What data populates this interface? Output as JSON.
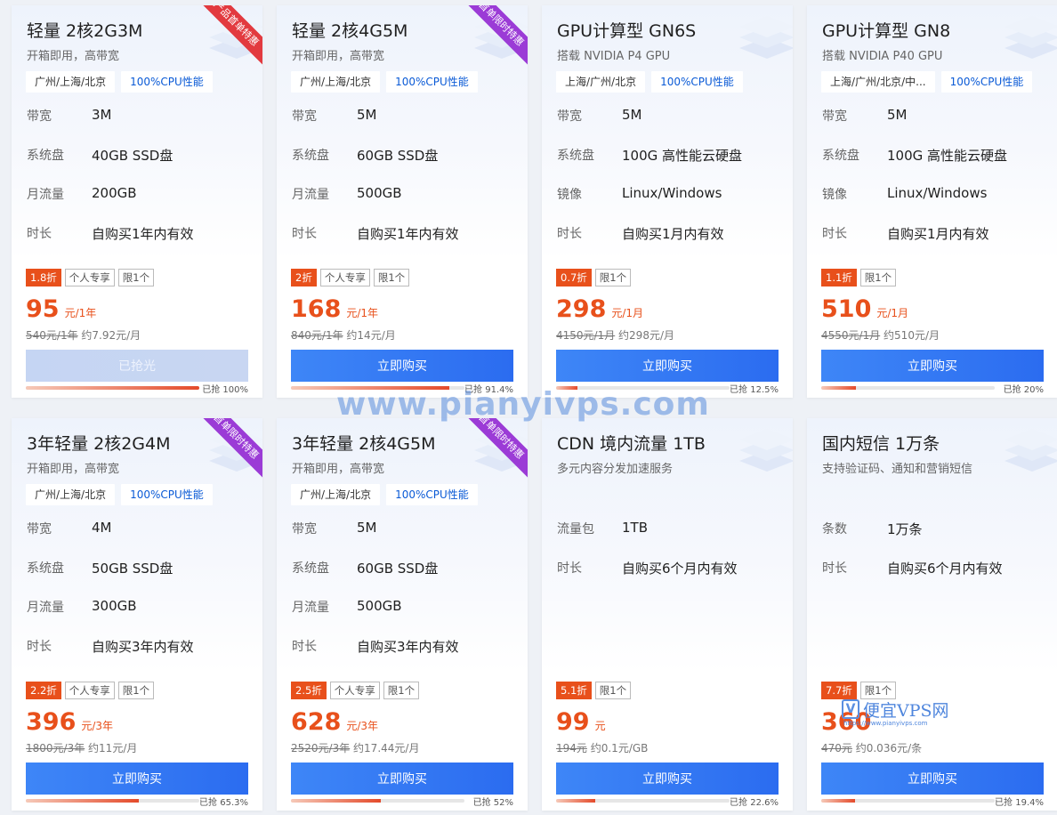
{
  "watermark": "www.pianyivps.com",
  "logo": {
    "mark": "V",
    "name": "便宜VPS网",
    "url": "https://www.pianyivps.com"
  },
  "cards": [
    {
      "title": "轻量 2核2G3M",
      "subtitle": "开箱即用，高带宽",
      "tags": [
        "广州/上海/北京",
        "100%CPU性能"
      ],
      "ribbon": "产品首单特惠",
      "specs": [
        {
          "k": "带宽",
          "v": "3M"
        },
        {
          "k": "系统盘",
          "v": "40GB SSD盘"
        },
        {
          "k": "月流量",
          "v": "200GB"
        },
        {
          "k": "时长",
          "v": "自购买1年内有效"
        }
      ],
      "discount": "1.8折",
      "badges": [
        "个人专享",
        "限1个"
      ],
      "price": "95",
      "unit": "元/1年",
      "orig": "540元/1年",
      "avg": "约7.92元/月",
      "button": "已抢光",
      "sold_text": "已抢 100%",
      "sold": 1.0
    },
    {
      "title": "轻量 2核4G5M",
      "subtitle": "开箱即用，高带宽",
      "tags": [
        "广州/上海/北京",
        "100%CPU性能"
      ],
      "ribbon": "首单限时特惠",
      "specs": [
        {
          "k": "带宽",
          "v": "5M"
        },
        {
          "k": "系统盘",
          "v": "60GB SSD盘"
        },
        {
          "k": "月流量",
          "v": "500GB"
        },
        {
          "k": "时长",
          "v": "自购买1年内有效"
        }
      ],
      "discount": "2折",
      "badges": [
        "个人专享",
        "限1个"
      ],
      "price": "168",
      "unit": "元/1年",
      "orig": "840元/1年",
      "avg": "约14元/月",
      "button": "立即购买",
      "sold_text": "已抢 91.4%",
      "sold": 0.914
    },
    {
      "title": "GPU计算型 GN6S",
      "subtitle": "搭载 NVIDIA P4 GPU",
      "tags": [
        "上海/广州/北京",
        "100%CPU性能"
      ],
      "ribbon": "",
      "specs": [
        {
          "k": "带宽",
          "v": "5M"
        },
        {
          "k": "系统盘",
          "v": "100G 高性能云硬盘"
        },
        {
          "k": "镜像",
          "v": "Linux/Windows"
        },
        {
          "k": "时长",
          "v": "自购买1月内有效"
        }
      ],
      "discount": "0.7折",
      "badges": [
        "限1个"
      ],
      "price": "298",
      "unit": "元/1月",
      "orig": "4150元/1月",
      "avg": "约298元/月",
      "button": "立即购买",
      "sold_text": "已抢 12.5%",
      "sold": 0.125
    },
    {
      "title": "GPU计算型 GN8",
      "subtitle": "搭载 NVIDIA P40 GPU",
      "tags": [
        "上海/广州/北京/中...",
        "100%CPU性能"
      ],
      "ribbon": "",
      "specs": [
        {
          "k": "带宽",
          "v": "5M"
        },
        {
          "k": "系统盘",
          "v": "100G 高性能云硬盘"
        },
        {
          "k": "镜像",
          "v": "Linux/Windows"
        },
        {
          "k": "时长",
          "v": "自购买1月内有效"
        }
      ],
      "discount": "1.1折",
      "badges": [
        "限1个"
      ],
      "price": "510",
      "unit": "元/1月",
      "orig": "4550元/1月",
      "avg": "约510元/月",
      "button": "立即购买",
      "sold_text": "已抢 20%",
      "sold": 0.2
    },
    {
      "title": "3年轻量 2核2G4M",
      "subtitle": "开箱即用，高带宽",
      "tags": [
        "广州/上海/北京",
        "100%CPU性能"
      ],
      "ribbon": "首单限时特惠",
      "specs": [
        {
          "k": "带宽",
          "v": "4M"
        },
        {
          "k": "系统盘",
          "v": "50GB SSD盘"
        },
        {
          "k": "月流量",
          "v": "300GB"
        },
        {
          "k": "时长",
          "v": "自购买3年内有效"
        }
      ],
      "discount": "2.2折",
      "badges": [
        "个人专享",
        "限1个"
      ],
      "price": "396",
      "unit": "元/3年",
      "orig": "1800元/3年",
      "avg": "约11元/月",
      "button": "立即购买",
      "sold_text": "已抢 65.3%",
      "sold": 0.653
    },
    {
      "title": "3年轻量 2核4G5M",
      "subtitle": "开箱即用，高带宽",
      "tags": [
        "广州/上海/北京",
        "100%CPU性能"
      ],
      "ribbon": "首单限时特惠",
      "specs": [
        {
          "k": "带宽",
          "v": "5M"
        },
        {
          "k": "系统盘",
          "v": "60GB SSD盘"
        },
        {
          "k": "月流量",
          "v": "500GB"
        },
        {
          "k": "时长",
          "v": "自购买3年内有效"
        }
      ],
      "discount": "2.5折",
      "badges": [
        "个人专享",
        "限1个"
      ],
      "price": "628",
      "unit": "元/3年",
      "orig": "2520元/3年",
      "avg": "约17.44元/月",
      "button": "立即购买",
      "sold_text": "已抢 52%",
      "sold": 0.52
    },
    {
      "title": "CDN 境内流量 1TB",
      "subtitle": "多元内容分发加速服务",
      "tags": [],
      "ribbon": "",
      "specs": [
        {
          "k": "流量包",
          "v": "1TB"
        },
        {
          "k": "时长",
          "v": "自购买6个月内有效"
        }
      ],
      "discount": "5.1折",
      "badges": [
        "限1个"
      ],
      "price": "99",
      "unit": "元",
      "orig": "194元",
      "avg": "约0.1元/GB",
      "button": "立即购买",
      "sold_text": "已抢 22.6%",
      "sold": 0.226
    },
    {
      "title": "国内短信 1万条",
      "subtitle": "支持验证码、通知和营销短信",
      "tags": [],
      "ribbon": "",
      "specs": [
        {
          "k": "条数",
          "v": "1万条"
        },
        {
          "k": "时长",
          "v": "自购买6个月内有效"
        }
      ],
      "discount": "7.7折",
      "badges": [
        "限1个"
      ],
      "price": "360",
      "unit": "",
      "orig": "470元",
      "avg": "约0.036元/条",
      "button": "立即购买",
      "sold_text": "已抢 19.4%",
      "sold": 0.194
    }
  ]
}
